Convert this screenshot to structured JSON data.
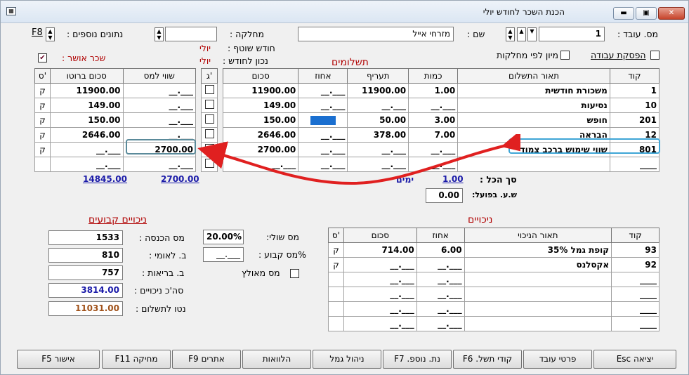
{
  "window": {
    "title": "הכנת השכר לחודש יולי",
    "icon": "app-icon",
    "min_icon": "minimize-icon",
    "max_icon": "maximize-icon",
    "close_icon": "close-icon"
  },
  "header": {
    "employee_no_label": "מס. עובד :",
    "employee_no": "1",
    "name_label": "שם :",
    "name": "מזרחי אייל",
    "department_label": "מחלקה :",
    "department": "",
    "extra_data_label": "נתונים נוספים :",
    "extra_data_key": "F8",
    "current_month_label": "חודש שוטף :",
    "current_month": "יולי",
    "correct_for_label": "נכון לחודש :",
    "correct_for": "יולי",
    "approved_salary_label": "שכר אושר :",
    "approved_salary_checked": "✔",
    "work_stop_label": "הפסקת עבודה",
    "sort_by_dept_label": "מיון לפי מחלקות"
  },
  "payments": {
    "heading": "תשלומים",
    "columns": [
      "קוד",
      "תאור התשלום",
      "כמות",
      "תעריף",
      "אחוז",
      "סכום",
      "ג'"
    ],
    "rows": [
      {
        "code": "1",
        "desc": "משכורת חודשית",
        "qty": "1.00",
        "rate": "11900.00",
        "pct": "__.___",
        "sum": "11900.00"
      },
      {
        "code": "10",
        "desc": "נסיעות",
        "qty": "__.___",
        "rate": "__.___",
        "pct": "__.___",
        "sum": "149.00"
      },
      {
        "code": "201",
        "desc": "חופש",
        "qty": "3.00",
        "rate": "50.00",
        "pct": "",
        "sum": "150.00"
      },
      {
        "code": "12",
        "desc": "הבראה",
        "qty": "7.00",
        "rate": "378.00",
        "pct": "__.___",
        "sum": "2646.00"
      },
      {
        "code": "801",
        "desc": "שווי שימוש ברכב צמוד",
        "qty": "__.___",
        "rate": "__.___",
        "pct": "__.___",
        "sum": "2700.00"
      },
      {
        "code": "____",
        "desc": "",
        "qty": "__.___",
        "rate": "__.___",
        "pct": "__.___",
        "sum": "__.___"
      }
    ],
    "total_label": "סך הכל :",
    "days_value": "1.00",
    "days_label": "ימים",
    "actual_hours_label": "ש.ע. בפועל:",
    "actual_hours": "0.00"
  },
  "tax_table": {
    "columns": [
      "שווי למס",
      "סכום ברוטו",
      "ס'"
    ],
    "rows": [
      {
        "tax": "__.___",
        "gross": "11900.00",
        "s": "ק"
      },
      {
        "tax": "__.___",
        "gross": "149.00",
        "s": "ק"
      },
      {
        "tax": "__.___",
        "gross": "150.00",
        "s": "ק"
      },
      {
        "tax": "__.___",
        "gross": "2646.00",
        "s": "ק"
      },
      {
        "tax": "2700.00",
        "gross": "__.___",
        "s": "ק"
      },
      {
        "tax": "__.___",
        "gross": "__.___",
        "s": ""
      }
    ],
    "total_tax": "2700.00",
    "total_gross": "14845.00"
  },
  "deductions": {
    "heading": "ניכויים",
    "columns": [
      "קוד",
      "תאור הניכוי",
      "אחוז",
      "סכום",
      "ס'"
    ],
    "rows": [
      {
        "code": "93",
        "desc": "קופת גמל 35%",
        "pct": "6.00",
        "sum": "714.00",
        "s": "ק"
      },
      {
        "code": "92",
        "desc": "אקסלנס",
        "pct": "__.___",
        "sum": "__.___",
        "s": "ק"
      },
      {
        "code": "____",
        "desc": "",
        "pct": "__.___",
        "sum": "__.___",
        "s": ""
      },
      {
        "code": "____",
        "desc": "",
        "pct": "__.___",
        "sum": "__.___",
        "s": ""
      },
      {
        "code": "____",
        "desc": "",
        "pct": "__.___",
        "sum": "__.___",
        "s": ""
      },
      {
        "code": "____",
        "desc": "",
        "pct": "__.___",
        "sum": "__.___",
        "s": ""
      }
    ],
    "marginal_tax_label": "מס שולי:",
    "marginal_tax": "20.00%",
    "fixed_tax_label": "%מס קבוע :",
    "fixed_tax": "__.___",
    "credited_tax_label": "מס מאולץ"
  },
  "fixed_deductions": {
    "heading": "ניכויים קבועים",
    "income_tax_label": "מס הכנסה :",
    "income_tax": "1533",
    "national_ins_label": "ב. לאומי :",
    "national_ins": "810",
    "health_ins_label": "ב. בריאות :",
    "health_ins": "757",
    "total_label": "סה'כ ניכויים :",
    "total": "3814.00",
    "net_label": "נטו לתשלום :",
    "net": "11031.00"
  },
  "buttons": {
    "exit": "יציאה Esc",
    "employee_details": "פרטי עובד",
    "payment_codes": "קודי תשל. F6",
    "extra_data": "נת. נוספ. F7",
    "provident": "ניהול גמל",
    "loans": "הלוואות",
    "alerts": "אתרים F9",
    "delete": "מחיקה F11",
    "approve": "אישור F5"
  },
  "colors": {
    "arrow": "#e02020",
    "highlight": "#3ea5d6",
    "net": "#a0521a",
    "total_blue": "#1a1aa8",
    "label_red": "#b00000"
  }
}
